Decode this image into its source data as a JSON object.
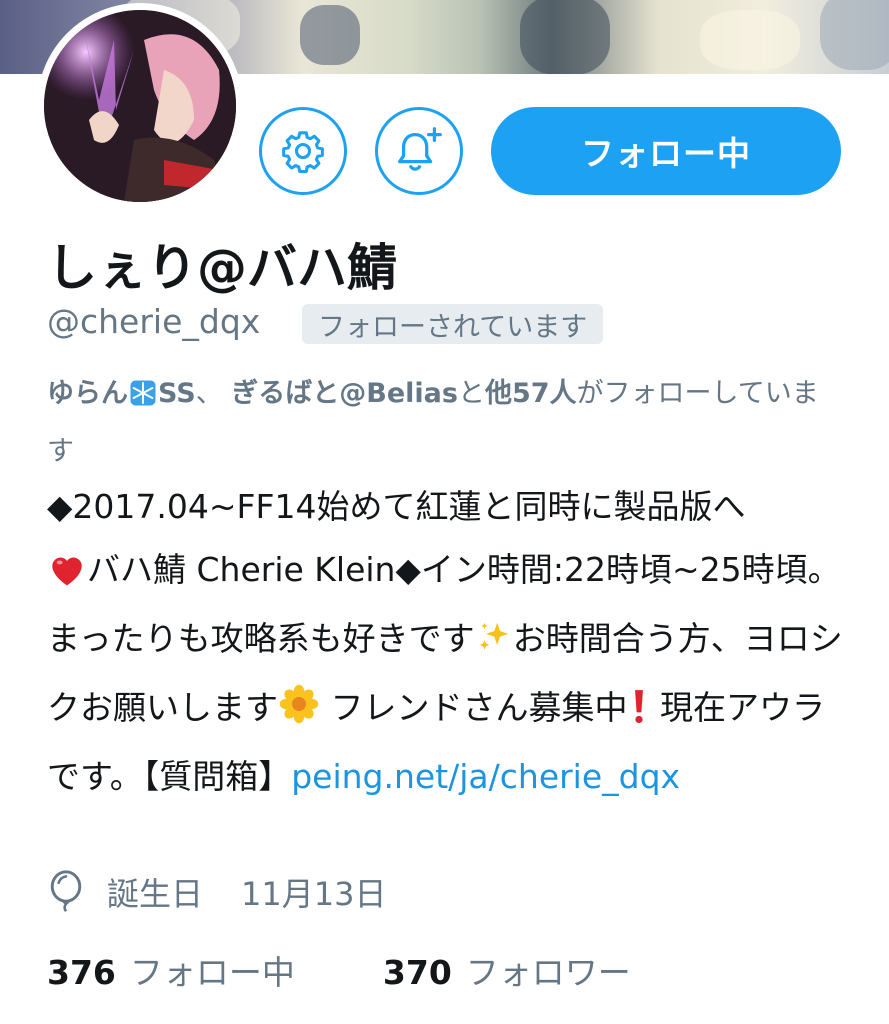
{
  "profile": {
    "display_name": "しぇり@バハ鯖",
    "handle": "@cherie_dqx",
    "follows_you_badge": "フォローされています",
    "follow_button_label": "フォロー中"
  },
  "followed_by": {
    "user1": "ゆらん",
    "user1_suffix": "SS",
    "separator": "、",
    "user2": "ぎるばと@Belias",
    "connector": "と",
    "others": "他57人",
    "tail": "がフォローしています"
  },
  "bio": {
    "line1": "◆2017.04~FF14始めて紅蓮と同時に製品版へ",
    "seg2": "バハ鯖 Cherie Klein◆イン時間:22時頃~25時頃。まったりも攻略系も好きです",
    "seg3": "お時間合う方、ヨロシクお願いします",
    "seg4": " フレンドさん募集中",
    "seg5": " 現在アウラです。【質問箱】",
    "link": "peing.net/ja/cherie_dqx"
  },
  "birthday": {
    "label": "誕生日",
    "value": "11月13日"
  },
  "stats": {
    "following_count": "376",
    "following_label": "フォロー中",
    "followers_count": "370",
    "followers_label": "フォロワー"
  },
  "icons": {
    "settings": "gear-icon",
    "notifications": "bell-plus-icon",
    "birthday": "balloon-icon"
  },
  "colors": {
    "accent": "#1da1f2",
    "link": "#1b95e0",
    "secondary_text": "#657786",
    "badge_bg": "#e6ecf0"
  }
}
